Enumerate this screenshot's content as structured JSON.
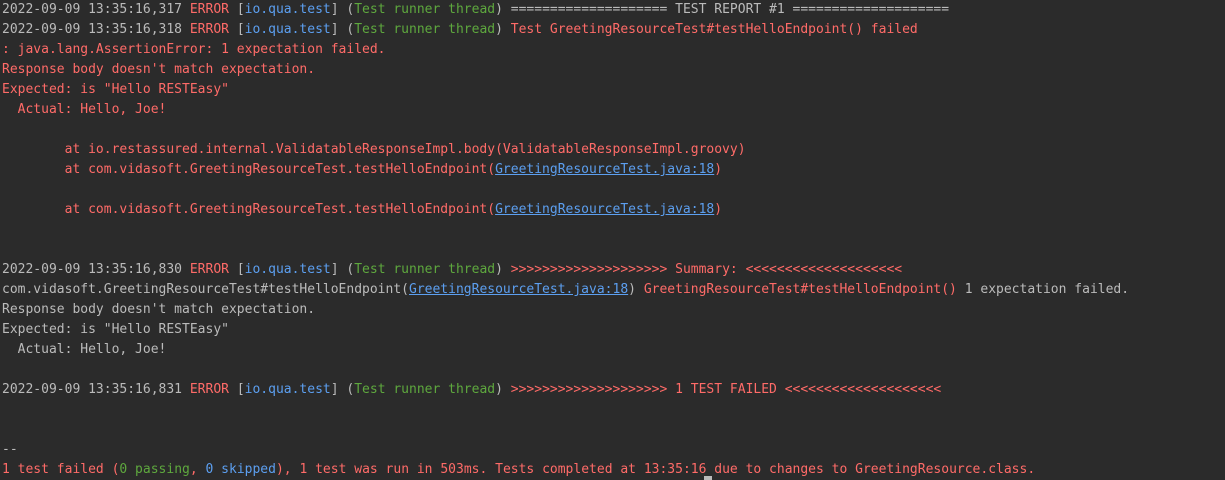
{
  "lines": [
    {
      "timestamp": "2022-09-09 13:35:16,317",
      "level": "ERROR",
      "logger": "io.qua.test",
      "thread": "Test runner thread",
      "message": "==================== TEST REPORT #1 ===================="
    },
    {
      "timestamp": "2022-09-09 13:35:16,318",
      "level": "ERROR",
      "logger": "io.qua.test",
      "thread": "Test runner thread",
      "message": "Test GreetingResourceTest#testHelloEndpoint() failed"
    }
  ],
  "trace": {
    "exception": ": java.lang.AssertionError: 1 expectation failed.",
    "body_mismatch": "Response body doesn't match expectation.",
    "expected": "Expected: is \"Hello RESTEasy\"",
    "actual": "  Actual: Hello, Joe!",
    "frame1": "        at io.restassured.internal.ValidatableResponseImpl.body(ValidatableResponseImpl.groovy)",
    "frame2_prefix": "        at com.vidasoft.GreetingResourceTest.testHelloEndpoint(",
    "frame2_link": "GreetingResourceTest.java:18",
    "frame2_suffix": ")",
    "frame3_prefix": "        at com.vidasoft.GreetingResourceTest.testHelloEndpoint(",
    "frame3_link": "GreetingResourceTest.java:18",
    "frame3_suffix": ")"
  },
  "summary": {
    "timestamp": "2022-09-09 13:35:16,830",
    "level": "ERROR",
    "logger": "io.qua.test",
    "thread": "Test runner thread",
    "message": ">>>>>>>>>>>>>>>>>>>> Summary: <<<<<<<<<<<<<<<<<<<<",
    "location_prefix": "com.vidasoft.GreetingResourceTest#testHelloEndpoint(",
    "location_link": "GreetingResourceTest.java:18",
    "location_suffix": ")",
    "test_name": "GreetingResourceTest#testHelloEndpoint()",
    "result": "1 expectation failed.",
    "body_mismatch": "Response body doesn't match expectation.",
    "expected": "Expected: is \"Hello RESTEasy\"",
    "actual": "  Actual: Hello, Joe!"
  },
  "failed_line": {
    "timestamp": "2022-09-09 13:35:16,831",
    "level": "ERROR",
    "logger": "io.qua.test",
    "thread": "Test runner thread",
    "message": ">>>>>>>>>>>>>>>>>>>> 1 TEST FAILED <<<<<<<<<<<<<<<<<<<<"
  },
  "separator": "--",
  "status": {
    "failed": "1 test failed",
    "paren_open": " (",
    "passing": "0 passing",
    "comma": ", ",
    "skipped": "0 skipped",
    "paren_close": "), ",
    "rest": "1 test was run in 503ms. Tests completed at 13:35:16 due to changes to GreetingResource.class."
  },
  "colors": {
    "background": "#2b2b2b",
    "text": "#bbbbbb",
    "error": "#ff6b68",
    "logger": "#5c9ff0",
    "thread": "#5ea83e",
    "link": "#5c9ff0"
  }
}
